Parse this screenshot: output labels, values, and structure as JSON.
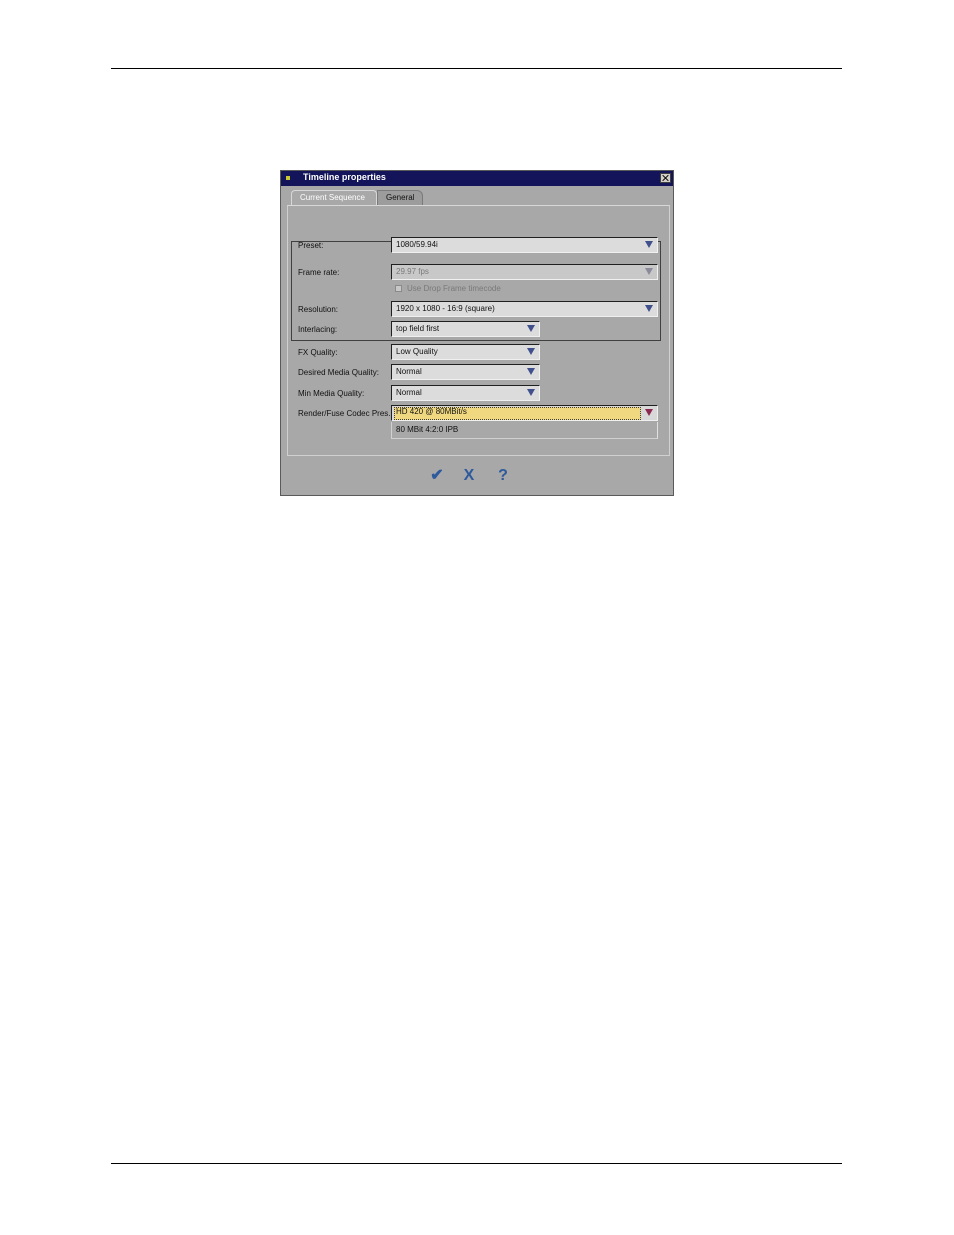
{
  "dialog": {
    "title": "Timeline properties",
    "tabs": [
      {
        "label": "Current Sequence",
        "active": true
      },
      {
        "label": "General",
        "active": false
      }
    ],
    "fields": {
      "preset": {
        "label": "Preset:",
        "value": "1080/59.94i"
      },
      "frame_rate": {
        "label": "Frame rate:",
        "value": "29.97 fps",
        "disabled": true
      },
      "drop_frame": {
        "label": "Use Drop Frame timecode",
        "checked": false,
        "disabled": true
      },
      "resolution": {
        "label": "Resolution:",
        "value": "1920 x 1080 - 16:9 (square)"
      },
      "interlacing": {
        "label": "Interlacing:",
        "value": "top field first"
      },
      "fx_quality": {
        "label": "FX Quality:",
        "value": "Low Quality"
      },
      "desired_media_quality": {
        "label": "Desired Media Quality:",
        "value": "Normal"
      },
      "min_media_quality": {
        "label": "Min Media Quality:",
        "value": "Normal"
      },
      "render_codec": {
        "label": "Render/Fuse Codec Pres.",
        "value": "HD 420 @ 80MBit/s",
        "info": "80 MBit 4:2:0 IPB"
      }
    },
    "buttons": {
      "ok": "✔",
      "cancel": "X",
      "help": "?"
    }
  }
}
